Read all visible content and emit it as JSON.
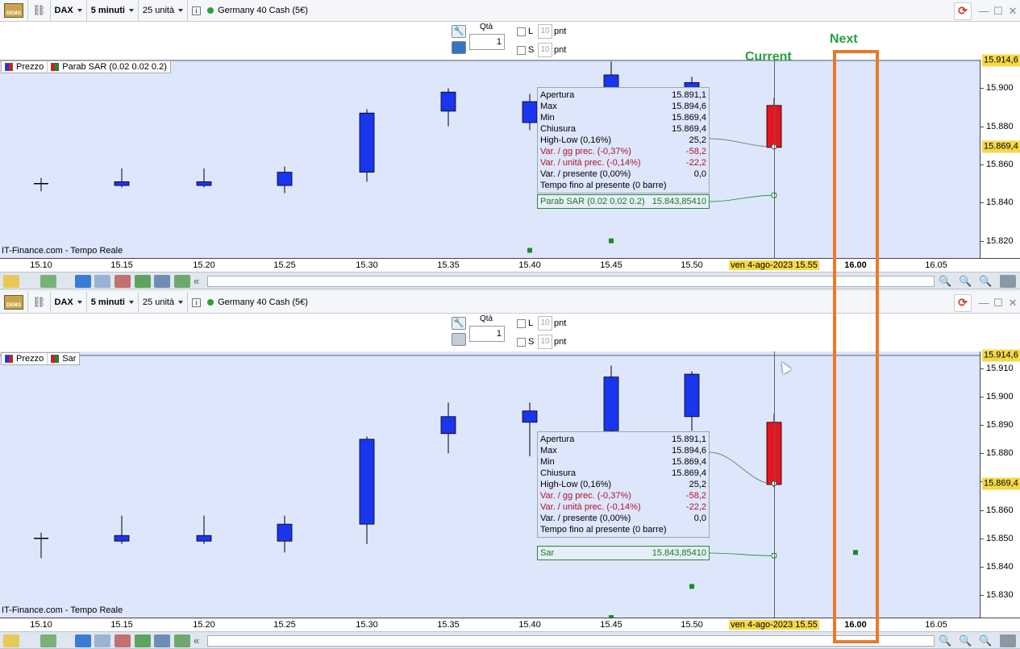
{
  "colors": {
    "bull": "#1a35ee",
    "bear": "#e8131d",
    "sar": "#1c8a2a",
    "annotation": "#27a03f",
    "highlight_box": "#ea7a2a",
    "plot_bg": "#dde6fb"
  },
  "annotations": {
    "current": "Current",
    "next": "Next"
  },
  "x_labels": [
    "15.10",
    "15.15",
    "15.20",
    "15.25",
    "15.30",
    "15.35",
    "15.40",
    "15.45",
    "15.50",
    "16.00",
    "16.05"
  ],
  "x_highlight": "ven 4-ago-2023 15.55",
  "panels": [
    {
      "header": {
        "demo": "DEMO",
        "symbol": "DAX",
        "timeframe": "5 minuti",
        "units": "25 unità",
        "instrument": "Germany 40 Cash (5€)"
      },
      "order": {
        "qty_label": "Qtà",
        "qty_value": "1",
        "long": "L",
        "short": "S",
        "pnt_value": "10",
        "pnt_unit": "pnt"
      },
      "legend": [
        {
          "label": "Prezzo",
          "icon": "price-icon"
        },
        {
          "label": "Parab SAR (0.02 0.02 0.2)",
          "icon": "sar-icon"
        }
      ],
      "source": "IT-Finance.com - Tempo Reale",
      "y_ticks": [
        "15.900",
        "15.880",
        "15.860",
        "15.840",
        "15.820"
      ],
      "y_top": "15.914,6",
      "y_price": "15.869,4",
      "chart_data": {
        "type": "candlestick",
        "y_range": [
          15811,
          15915
        ],
        "x": [
          "15.10",
          "15.15",
          "15.20",
          "15.25",
          "15.30",
          "15.35",
          "15.40",
          "15.45",
          "15.50",
          "15.55",
          "16.00"
        ],
        "open": [
          15850,
          15849,
          15849,
          15849,
          15856,
          15888,
          15882,
          15895,
          15899,
          15891,
          null
        ],
        "close": [
          15850,
          15851,
          15851,
          15856,
          15887,
          15898,
          15893,
          15907,
          15903,
          15869,
          null
        ],
        "high": [
          15853,
          15858,
          15858,
          15859,
          15889,
          15900,
          15897,
          15914,
          15906,
          15895,
          null
        ],
        "low": [
          15846,
          15848,
          15848,
          15845,
          15851,
          15880,
          15878,
          15887,
          15888,
          15868,
          null
        ],
        "sar": [
          null,
          null,
          null,
          null,
          null,
          null,
          15815,
          15820,
          null,
          15843.9,
          null
        ]
      },
      "tooltip": {
        "rows": [
          [
            "Apertura",
            "15.891,1"
          ],
          [
            "Max",
            "15.894,6"
          ],
          [
            "Min",
            "15.869,4"
          ],
          [
            "Chiusura",
            "15.869,4"
          ],
          [
            "High-Low (0,16%)",
            "25,2"
          ]
        ],
        "red_rows": [
          [
            "Var. / gg prec. (-0,37%)",
            "-58,2"
          ],
          [
            "Var. / unità prec. (-0,14%)",
            "-22,2"
          ]
        ],
        "rows2": [
          [
            "Var. / presente (0,00%)",
            "0,0"
          ]
        ],
        "footer": "Tempo fino al presente (0 barre)"
      },
      "sar_box": {
        "label": "Parab SAR (0.02 0.02 0.2)",
        "value": "15.843,85410"
      }
    },
    {
      "header": {
        "demo": "DEMO",
        "symbol": "DAX",
        "timeframe": "5 minuti",
        "units": "25 unità",
        "instrument": "Germany 40 Cash (5€)"
      },
      "order": {
        "qty_label": "Qtà",
        "qty_value": "1",
        "long": "L",
        "short": "S",
        "pnt_value": "10",
        "pnt_unit": "pnt"
      },
      "legend": [
        {
          "label": "Prezzo",
          "icon": "price-icon"
        },
        {
          "label": "Sar",
          "icon": "sar-icon"
        }
      ],
      "source": "IT-Finance.com - Tempo Reale",
      "y_ticks": [
        "15.910",
        "15.900",
        "15.890",
        "15.880",
        "15.870",
        "15.860",
        "15.850",
        "15.840",
        "15.830"
      ],
      "y_top": "15.914,6",
      "y_price": "15.869,4",
      "chart_data": {
        "type": "candlestick",
        "y_range": [
          15822,
          15916
        ],
        "x": [
          "15.10",
          "15.15",
          "15.20",
          "15.25",
          "15.30",
          "15.35",
          "15.40",
          "15.45",
          "15.50",
          "15.55",
          "16.00"
        ],
        "open": [
          15850,
          15849,
          15849,
          15849,
          15855,
          15887,
          15891,
          15888,
          15893,
          15891,
          null
        ],
        "close": [
          15850,
          15851,
          15851,
          15855,
          15885,
          15893,
          15895,
          15907,
          15908,
          15869,
          null
        ],
        "high": [
          15852,
          15858,
          15858,
          15858,
          15886,
          15898,
          15898,
          15911,
          15909,
          15894,
          null
        ],
        "low": [
          15843,
          15848,
          15848,
          15845,
          15848,
          15880,
          15879,
          15887,
          15888,
          15868,
          null
        ],
        "sar": [
          null,
          null,
          null,
          null,
          null,
          null,
          null,
          15822,
          15833,
          15843.9,
          15845
        ]
      },
      "tooltip": {
        "rows": [
          [
            "Apertura",
            "15.891,1"
          ],
          [
            "Max",
            "15.894,6"
          ],
          [
            "Min",
            "15.869,4"
          ],
          [
            "Chiusura",
            "15.869,4"
          ],
          [
            "High-Low (0,16%)",
            "25,2"
          ]
        ],
        "red_rows": [
          [
            "Var. / gg prec. (-0,37%)",
            "-58,2"
          ],
          [
            "Var. / unità prec. (-0,14%)",
            "-22,2"
          ]
        ],
        "rows2": [
          [
            "Var. / presente (0,00%)",
            "0,0"
          ]
        ],
        "footer": "Tempo fino al presente (0 barre)"
      },
      "sar_box": {
        "label": "Sar",
        "value": "15.843,85410"
      }
    }
  ]
}
